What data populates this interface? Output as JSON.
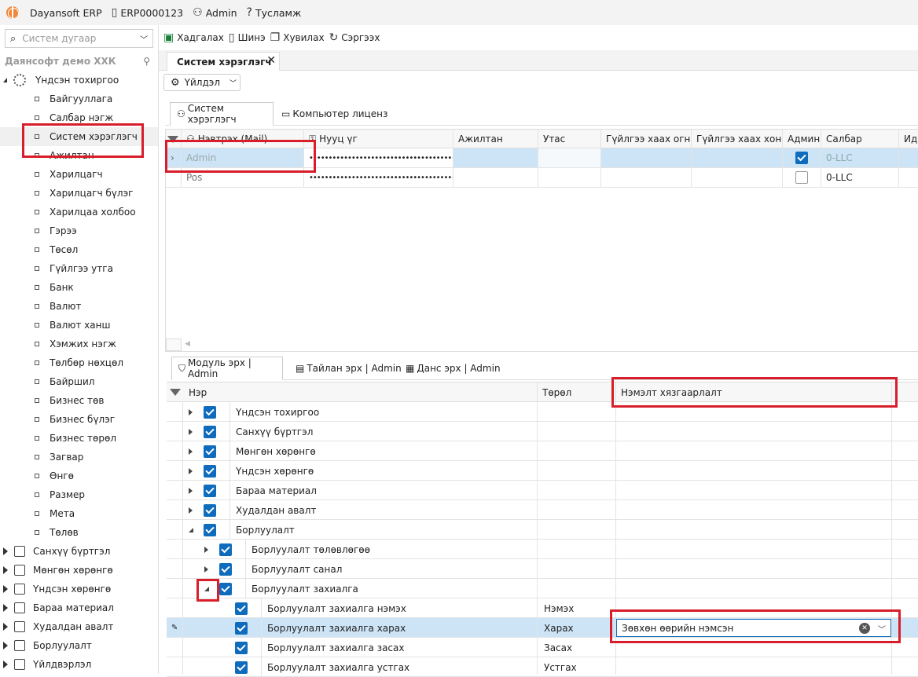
{
  "titlebar": {
    "app_name": "Dayansoft ERP",
    "database": "ERP0000123",
    "user": "Admin",
    "help": "Тусламж"
  },
  "left_panel": {
    "search_placeholder": "Систем дугаар",
    "company": "Даянсофт демо ХХК",
    "root": "Үндсэн тохиргоо",
    "items": [
      "Байгууллага",
      "Салбар нэгж",
      "Систем хэрэглэгч",
      "Ажилтан",
      "Харилцагч",
      "Харилцагч бүлэг",
      "Харилцаа холбоо",
      "Гэрээ",
      "Төсөл",
      "Гүйлгээ утга",
      "Банк",
      "Валют",
      "Валют ханш",
      "Хэмжих нэгж",
      "Төлбөр нөхцөл",
      "Байршил",
      "Бизнес төв",
      "Бизнес бүлэг",
      "Бизнес төрөл",
      "Загвар",
      "Өнгө",
      "Размер",
      "Мета",
      "Төлөв"
    ],
    "modules": [
      "Санхүү бүртгэл",
      "Мөнгөн хөрөнгө",
      "Үндсэн хөрөнгө",
      "Бараа материал",
      "Худалдан авалт",
      "Борлуулалт",
      "Үйлдвэрлэл"
    ]
  },
  "toolbar": {
    "save": "Хадгалах",
    "new": "Шинэ",
    "copy": "Хувилах",
    "refresh": "Сэргээх"
  },
  "tab": {
    "title": "Систем хэрэглэгч"
  },
  "action_button": "Үйлдэл",
  "subtabs": [
    "Систем хэрэглэгч",
    "Компьютер лиценз"
  ],
  "users_grid": {
    "columns": [
      "Нэвтрэх (Mail)",
      "Нууц үг",
      "Ажилтан",
      "Утас",
      "Гүйлгээ хаах огноо",
      "Гүйлгээ хаах хоног",
      "Админ",
      "Салбар",
      "Ид"
    ],
    "rows": [
      {
        "login": "Admin",
        "password": "••••••••••••••••••••••••••••••••••••••••••••",
        "admin": true,
        "branch": "0-LLC"
      },
      {
        "login": "Pos",
        "password": "••••••••••••••••••••••••••••••••••••••••••••",
        "admin": false,
        "branch": "0-LLC"
      }
    ]
  },
  "perm_tabs": [
    "Модуль эрх | Admin",
    "Тайлан эрх | Admin",
    "Данс эрх | Admin"
  ],
  "perm_grid": {
    "columns": [
      "Нэр",
      "Төрөл",
      "Нэмэлт хязгаарлалт"
    ],
    "rows": [
      {
        "name": "Үндсэн тохиргоо",
        "level": 0,
        "expand": "right",
        "type": ""
      },
      {
        "name": "Санхүү бүртгэл",
        "level": 0,
        "expand": "right",
        "type": ""
      },
      {
        "name": "Мөнгөн хөрөнгө",
        "level": 0,
        "expand": "right",
        "type": ""
      },
      {
        "name": "Үндсэн хөрөнгө",
        "level": 0,
        "expand": "right",
        "type": ""
      },
      {
        "name": "Бараа материал",
        "level": 0,
        "expand": "right",
        "type": ""
      },
      {
        "name": "Худалдан авалт",
        "level": 0,
        "expand": "right",
        "type": ""
      },
      {
        "name": "Борлуулалт",
        "level": 0,
        "expand": "down",
        "type": ""
      },
      {
        "name": "Борлуулалт төлөвлөгөө",
        "level": 1,
        "expand": "right",
        "type": ""
      },
      {
        "name": "Борлуулалт санал",
        "level": 1,
        "expand": "right",
        "type": ""
      },
      {
        "name": "Борлуулалт захиалга",
        "level": 1,
        "expand": "down",
        "type": ""
      },
      {
        "name": "Борлуулалт захиалга нэмэх",
        "level": 2,
        "expand": "",
        "type": "Нэмэх"
      },
      {
        "name": "Борлуулалт захиалга харах",
        "level": 2,
        "expand": "",
        "type": "Харах"
      },
      {
        "name": "Борлуулалт захиалга засах",
        "level": 2,
        "expand": "",
        "type": "Засах"
      },
      {
        "name": "Борлуулалт захиалга устгах",
        "level": 2,
        "expand": "",
        "type": "Устгах"
      }
    ],
    "restriction_value": "Зөвхөн өөрийн нэмсэн"
  }
}
